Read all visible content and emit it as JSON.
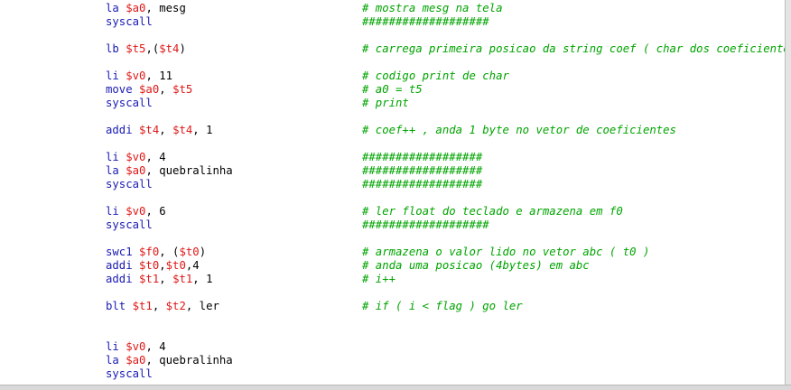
{
  "colors": {
    "keyword": "#1b1bb4",
    "register": "#e01818",
    "comment": "#00a400",
    "plain": "#000000"
  },
  "lines": [
    {
      "row": 0,
      "tokens": [
        {
          "t": "la",
          "k": "kw"
        },
        {
          "t": " ",
          "k": "plain"
        },
        {
          "t": "$a0",
          "k": "reg"
        },
        {
          "t": ", mesg",
          "k": "plain"
        }
      ],
      "comment": "# mostra mesg na tela"
    },
    {
      "row": 1,
      "tokens": [
        {
          "t": "syscall",
          "k": "kw"
        }
      ],
      "comment": "###################"
    },
    {
      "row": 3,
      "tokens": [
        {
          "t": "lb",
          "k": "kw"
        },
        {
          "t": " ",
          "k": "plain"
        },
        {
          "t": "$t5",
          "k": "reg"
        },
        {
          "t": ",(",
          "k": "plain"
        },
        {
          "t": "$t4",
          "k": "reg"
        },
        {
          "t": ")",
          "k": "plain"
        }
      ],
      "comment": "# carrega primeira posicao da string coef ( char dos coeficiente )"
    },
    {
      "row": 5,
      "tokens": [
        {
          "t": "li",
          "k": "kw"
        },
        {
          "t": " ",
          "k": "plain"
        },
        {
          "t": "$v0",
          "k": "reg"
        },
        {
          "t": ", 11",
          "k": "plain"
        }
      ],
      "comment": "# codigo print de char"
    },
    {
      "row": 6,
      "tokens": [
        {
          "t": "move",
          "k": "kw"
        },
        {
          "t": " ",
          "k": "plain"
        },
        {
          "t": "$a0",
          "k": "reg"
        },
        {
          "t": ", ",
          "k": "plain"
        },
        {
          "t": "$t5",
          "k": "reg"
        }
      ],
      "comment": "# a0 = t5"
    },
    {
      "row": 7,
      "tokens": [
        {
          "t": "syscall",
          "k": "kw"
        }
      ],
      "comment": "# print"
    },
    {
      "row": 9,
      "tokens": [
        {
          "t": "addi",
          "k": "kw"
        },
        {
          "t": " ",
          "k": "plain"
        },
        {
          "t": "$t4",
          "k": "reg"
        },
        {
          "t": ", ",
          "k": "plain"
        },
        {
          "t": "$t4",
          "k": "reg"
        },
        {
          "t": ", 1",
          "k": "plain"
        }
      ],
      "comment": "# coef++ , anda 1 byte no vetor de coeficientes"
    },
    {
      "row": 11,
      "tokens": [
        {
          "t": "li",
          "k": "kw"
        },
        {
          "t": " ",
          "k": "plain"
        },
        {
          "t": "$v0",
          "k": "reg"
        },
        {
          "t": ", 4",
          "k": "plain"
        }
      ],
      "comment": "##################"
    },
    {
      "row": 12,
      "tokens": [
        {
          "t": "la",
          "k": "kw"
        },
        {
          "t": " ",
          "k": "plain"
        },
        {
          "t": "$a0",
          "k": "reg"
        },
        {
          "t": ", quebralinha",
          "k": "plain"
        }
      ],
      "comment": "##################"
    },
    {
      "row": 13,
      "tokens": [
        {
          "t": "syscall",
          "k": "kw"
        }
      ],
      "comment": "##################"
    },
    {
      "row": 15,
      "tokens": [
        {
          "t": "li",
          "k": "kw"
        },
        {
          "t": " ",
          "k": "plain"
        },
        {
          "t": "$v0",
          "k": "reg"
        },
        {
          "t": ", 6",
          "k": "plain"
        }
      ],
      "comment": "# ler float do teclado e armazena em f0"
    },
    {
      "row": 16,
      "tokens": [
        {
          "t": "syscall",
          "k": "kw"
        }
      ],
      "comment": "###################"
    },
    {
      "row": 18,
      "tokens": [
        {
          "t": "swc1",
          "k": "kw"
        },
        {
          "t": " ",
          "k": "plain"
        },
        {
          "t": "$f0",
          "k": "reg"
        },
        {
          "t": ", (",
          "k": "plain"
        },
        {
          "t": "$t0",
          "k": "reg"
        },
        {
          "t": ")",
          "k": "plain"
        }
      ],
      "comment": "# armazena o valor lido no vetor abc ( t0 )"
    },
    {
      "row": 19,
      "tokens": [
        {
          "t": "addi",
          "k": "kw"
        },
        {
          "t": " ",
          "k": "plain"
        },
        {
          "t": "$t0",
          "k": "reg"
        },
        {
          "t": ",",
          "k": "plain"
        },
        {
          "t": "$t0",
          "k": "reg"
        },
        {
          "t": ",4",
          "k": "plain"
        }
      ],
      "comment": "# anda uma posicao (4bytes) em abc"
    },
    {
      "row": 20,
      "tokens": [
        {
          "t": "addi",
          "k": "kw"
        },
        {
          "t": " ",
          "k": "plain"
        },
        {
          "t": "$t1",
          "k": "reg"
        },
        {
          "t": ", ",
          "k": "plain"
        },
        {
          "t": "$t1",
          "k": "reg"
        },
        {
          "t": ", 1",
          "k": "plain"
        }
      ],
      "comment": "# i++"
    },
    {
      "row": 22,
      "tokens": [
        {
          "t": "blt",
          "k": "kw"
        },
        {
          "t": " ",
          "k": "plain"
        },
        {
          "t": "$t1",
          "k": "reg"
        },
        {
          "t": ", ",
          "k": "plain"
        },
        {
          "t": "$t2",
          "k": "reg"
        },
        {
          "t": ", ler",
          "k": "plain"
        }
      ],
      "comment": "# if ( i < flag ) go ler"
    },
    {
      "row": 25,
      "tokens": [
        {
          "t": "li",
          "k": "kw"
        },
        {
          "t": " ",
          "k": "plain"
        },
        {
          "t": "$v0",
          "k": "reg"
        },
        {
          "t": ", 4",
          "k": "plain"
        }
      ],
      "comment": ""
    },
    {
      "row": 26,
      "tokens": [
        {
          "t": "la",
          "k": "kw"
        },
        {
          "t": " ",
          "k": "plain"
        },
        {
          "t": "$a0",
          "k": "reg"
        },
        {
          "t": ", quebralinha",
          "k": "plain"
        }
      ],
      "comment": ""
    },
    {
      "row": 27,
      "tokens": [
        {
          "t": "syscall",
          "k": "kw"
        }
      ],
      "comment": ""
    }
  ]
}
